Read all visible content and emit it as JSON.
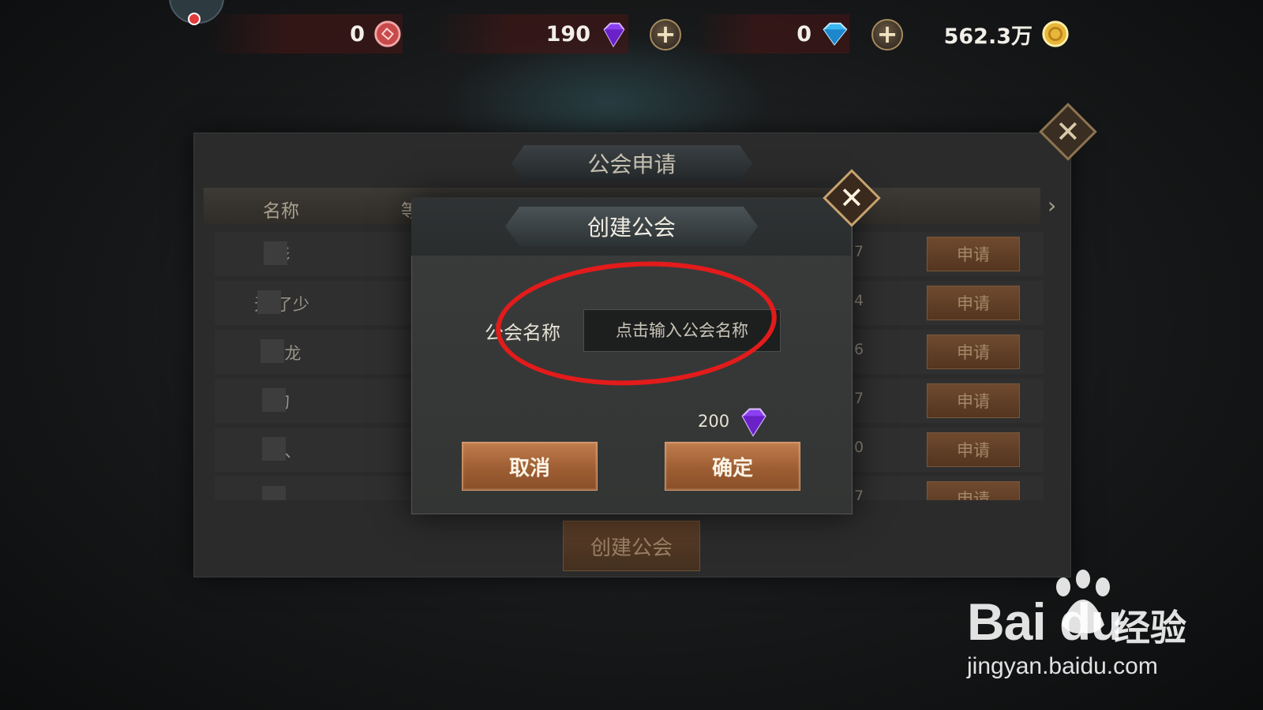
{
  "resources": {
    "badge_count": "0",
    "purple_gem_count": "190",
    "blue_gem_count": "0",
    "gold_count": "562.3万"
  },
  "back_panel": {
    "title": "公会申请",
    "col_name": "名称",
    "col_level": "等",
    "rows": [
      {
        "name": "彭",
        "num": "7",
        "apply": "申请"
      },
      {
        "name": "无 了少",
        "num": "4",
        "apply": "申请"
      },
      {
        "name": "大 龙",
        "num": "6",
        "apply": "申请"
      },
      {
        "name": "刀",
        "num": "7",
        "apply": "申请"
      },
      {
        "name": "天 、",
        "num": "0",
        "apply": "申请"
      },
      {
        "name": "-",
        "num": "7",
        "apply": "申请"
      }
    ],
    "create_button": "创建公会"
  },
  "dialog": {
    "title": "创建公会",
    "field_label": "公会名称",
    "input_placeholder": "点击输入公会名称",
    "cost": "200",
    "cancel": "取消",
    "confirm": "确定"
  },
  "watermark": {
    "logo": "Bai du",
    "cn": "经验",
    "url": "jingyan.baidu.com"
  },
  "colors": {
    "highlight": "#e31b1b",
    "button_orange": "#b06c3f",
    "purple_gem": "#8a3ff0",
    "blue_gem": "#3ab6f0",
    "gold": "#e8b63a"
  }
}
